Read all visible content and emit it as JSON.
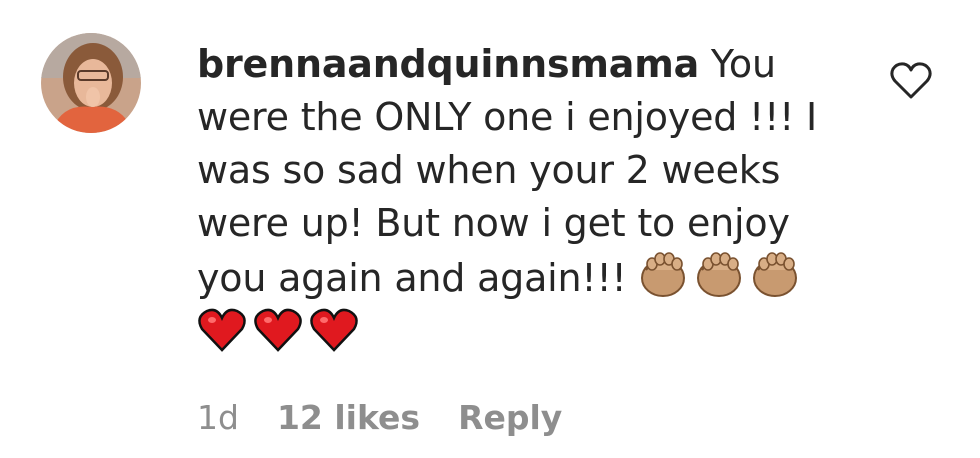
{
  "comment": {
    "username": "brennaandquinnsmama",
    "text_before_emoji": " You were the ONLY one i enjoyed !!! I was so sad when your 2 weeks were up! But now i get to enjoy you again and again!!! ",
    "emojis": [
      "clapping-hands",
      "clapping-hands",
      "clapping-hands",
      "red-heart",
      "red-heart",
      "red-heart"
    ],
    "time": "1d",
    "likes": "12 likes",
    "reply_label": "Reply"
  },
  "colors": {
    "text": "#262626",
    "meta": "#8e8e8e",
    "heart": "#e0191f",
    "clap": "#c89a70"
  },
  "icons": {
    "like": "heart-outline-icon",
    "avatar": "profile-avatar"
  }
}
